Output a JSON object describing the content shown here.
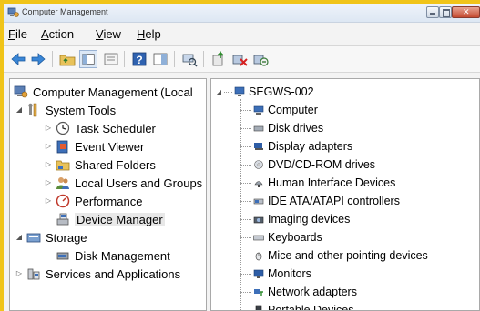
{
  "window": {
    "title": "Computer Management"
  },
  "menubar": {
    "items": [
      {
        "key": "F",
        "rest": "ile"
      },
      {
        "key": "A",
        "rest": "ction"
      },
      {
        "key": "V",
        "rest": "iew"
      },
      {
        "key": "H",
        "rest": "elp"
      }
    ]
  },
  "toolbar": {
    "buttons": [
      "back-arrow-icon",
      "forward-arrow-icon",
      "up-folder-icon",
      "show-hide-tree-icon",
      "properties-icon",
      "help-icon",
      "action-pane-icon",
      "scan-hardware-icon",
      "update-driver-icon",
      "disable-device-icon",
      "uninstall-device-icon"
    ]
  },
  "tree": {
    "root": "Computer Management (Local",
    "system_tools": "System Tools",
    "task_scheduler": "Task Scheduler",
    "event_viewer": "Event Viewer",
    "shared_folders": "Shared Folders",
    "local_users": "Local Users and Groups",
    "performance": "Performance",
    "device_manager": "Device Manager",
    "storage": "Storage",
    "disk_management": "Disk Management",
    "services": "Services and Applications"
  },
  "devices": {
    "computer_name": "SEGWS-002",
    "categories": [
      "Computer",
      "Disk drives",
      "Display adapters",
      "DVD/CD-ROM drives",
      "Human Interface Devices",
      "IDE ATA/ATAPI controllers",
      "Imaging devices",
      "Keyboards",
      "Mice and other pointing devices",
      "Monitors",
      "Network adapters",
      "Portable Devices"
    ]
  },
  "colors": {
    "frame": "#f0c419",
    "selection": "#e8e8e8",
    "title_bar": "#dde7f3"
  }
}
